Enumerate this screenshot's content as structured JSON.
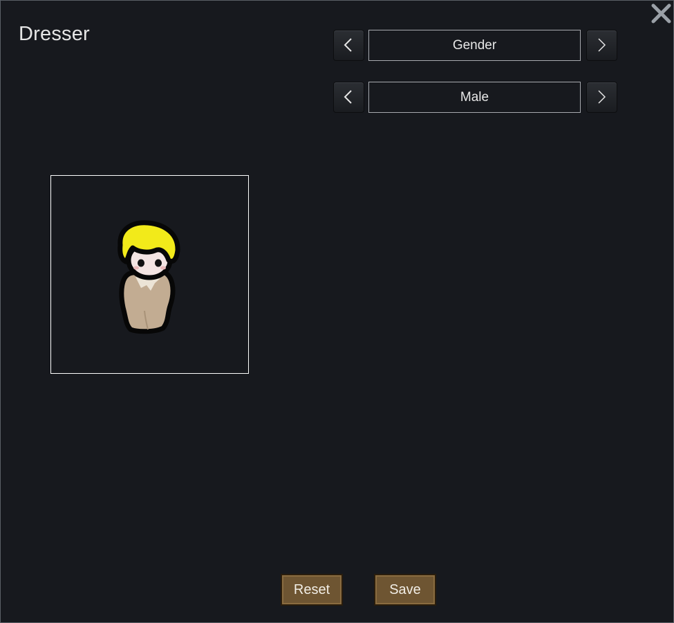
{
  "window": {
    "title": "Dresser"
  },
  "selectors": [
    {
      "label": "Gender"
    },
    {
      "label": "Male"
    }
  ],
  "icons": {
    "close": "close-icon",
    "prev": "chevron-left-icon",
    "next": "chevron-right-icon",
    "preview": "pawn-portrait"
  },
  "buttons": {
    "reset": "Reset",
    "save": "Save"
  },
  "colors": {
    "background": "#17191e",
    "button_brown": "#6e5532",
    "hair": "#f2ea1a",
    "apparel": "#c2ac92"
  }
}
